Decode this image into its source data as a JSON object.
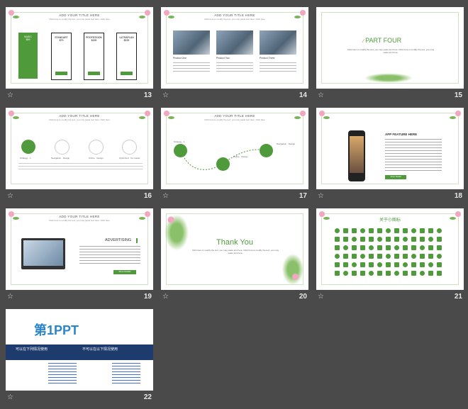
{
  "slides": [
    {
      "num": "13",
      "title": "ADD YOUR TITLE HERE",
      "sub": "Click here to modify the text, you may paste text here. Click here",
      "plans": [
        {
          "name": "BASIC",
          "price": "$59"
        },
        {
          "name": "STANDART",
          "price": "$79"
        },
        {
          "name": "PROFESSION",
          "price": "$159"
        },
        {
          "name": "ULTRAPLAN",
          "price": "$229"
        }
      ]
    },
    {
      "num": "14",
      "title": "ADD YOUR TITLE HERE",
      "sub": "Click here to modify the text, you may paste text here. Click here",
      "products": [
        "Product One",
        "Product Two",
        "Product Three"
      ]
    },
    {
      "num": "15",
      "part": "PART FOUR",
      "body": "Click here to modify the text, you may paste text here. Click here to modify the text, you may paste text here."
    },
    {
      "num": "16",
      "title": "ADD YOUR TITLE HERE",
      "sub": "Click here to modify the text, you may paste text here. Click here",
      "steps": [
        "Strategy · 1",
        "Navigation · Design",
        "Online · Design",
        "Optimized · Ite master"
      ]
    },
    {
      "num": "17",
      "title": "ADD YOUR TITLE HERE",
      "sub": "Click here to modify the text, you may paste text here. Click here",
      "steps": [
        "Strategy · 1",
        "Online · Design",
        "Navigation · Design"
      ]
    },
    {
      "num": "18",
      "heading": "APP FEATURE HERE",
      "btn": "View Detail"
    },
    {
      "num": "19",
      "title": "ADD YOUR TITLE HERE",
      "sub": "Click here to modify the text, you may paste text here. Click here",
      "heading": "ADVERTISING",
      "btn": "More Details"
    },
    {
      "num": "20",
      "heading": "Thank You",
      "body": "Click here to modify the text, you may paste text here. Click here to modify the text, you may paste text here."
    },
    {
      "num": "21",
      "heading": "关于小图标"
    },
    {
      "num": "22",
      "logo": "第1PPT",
      "left": "可以在下列情况使用",
      "right": "不可以在以下情况使用"
    }
  ],
  "colors": {
    "green": "#4f9a3a",
    "pink": "#f2a6c0",
    "bg": "#4a4a4a"
  }
}
